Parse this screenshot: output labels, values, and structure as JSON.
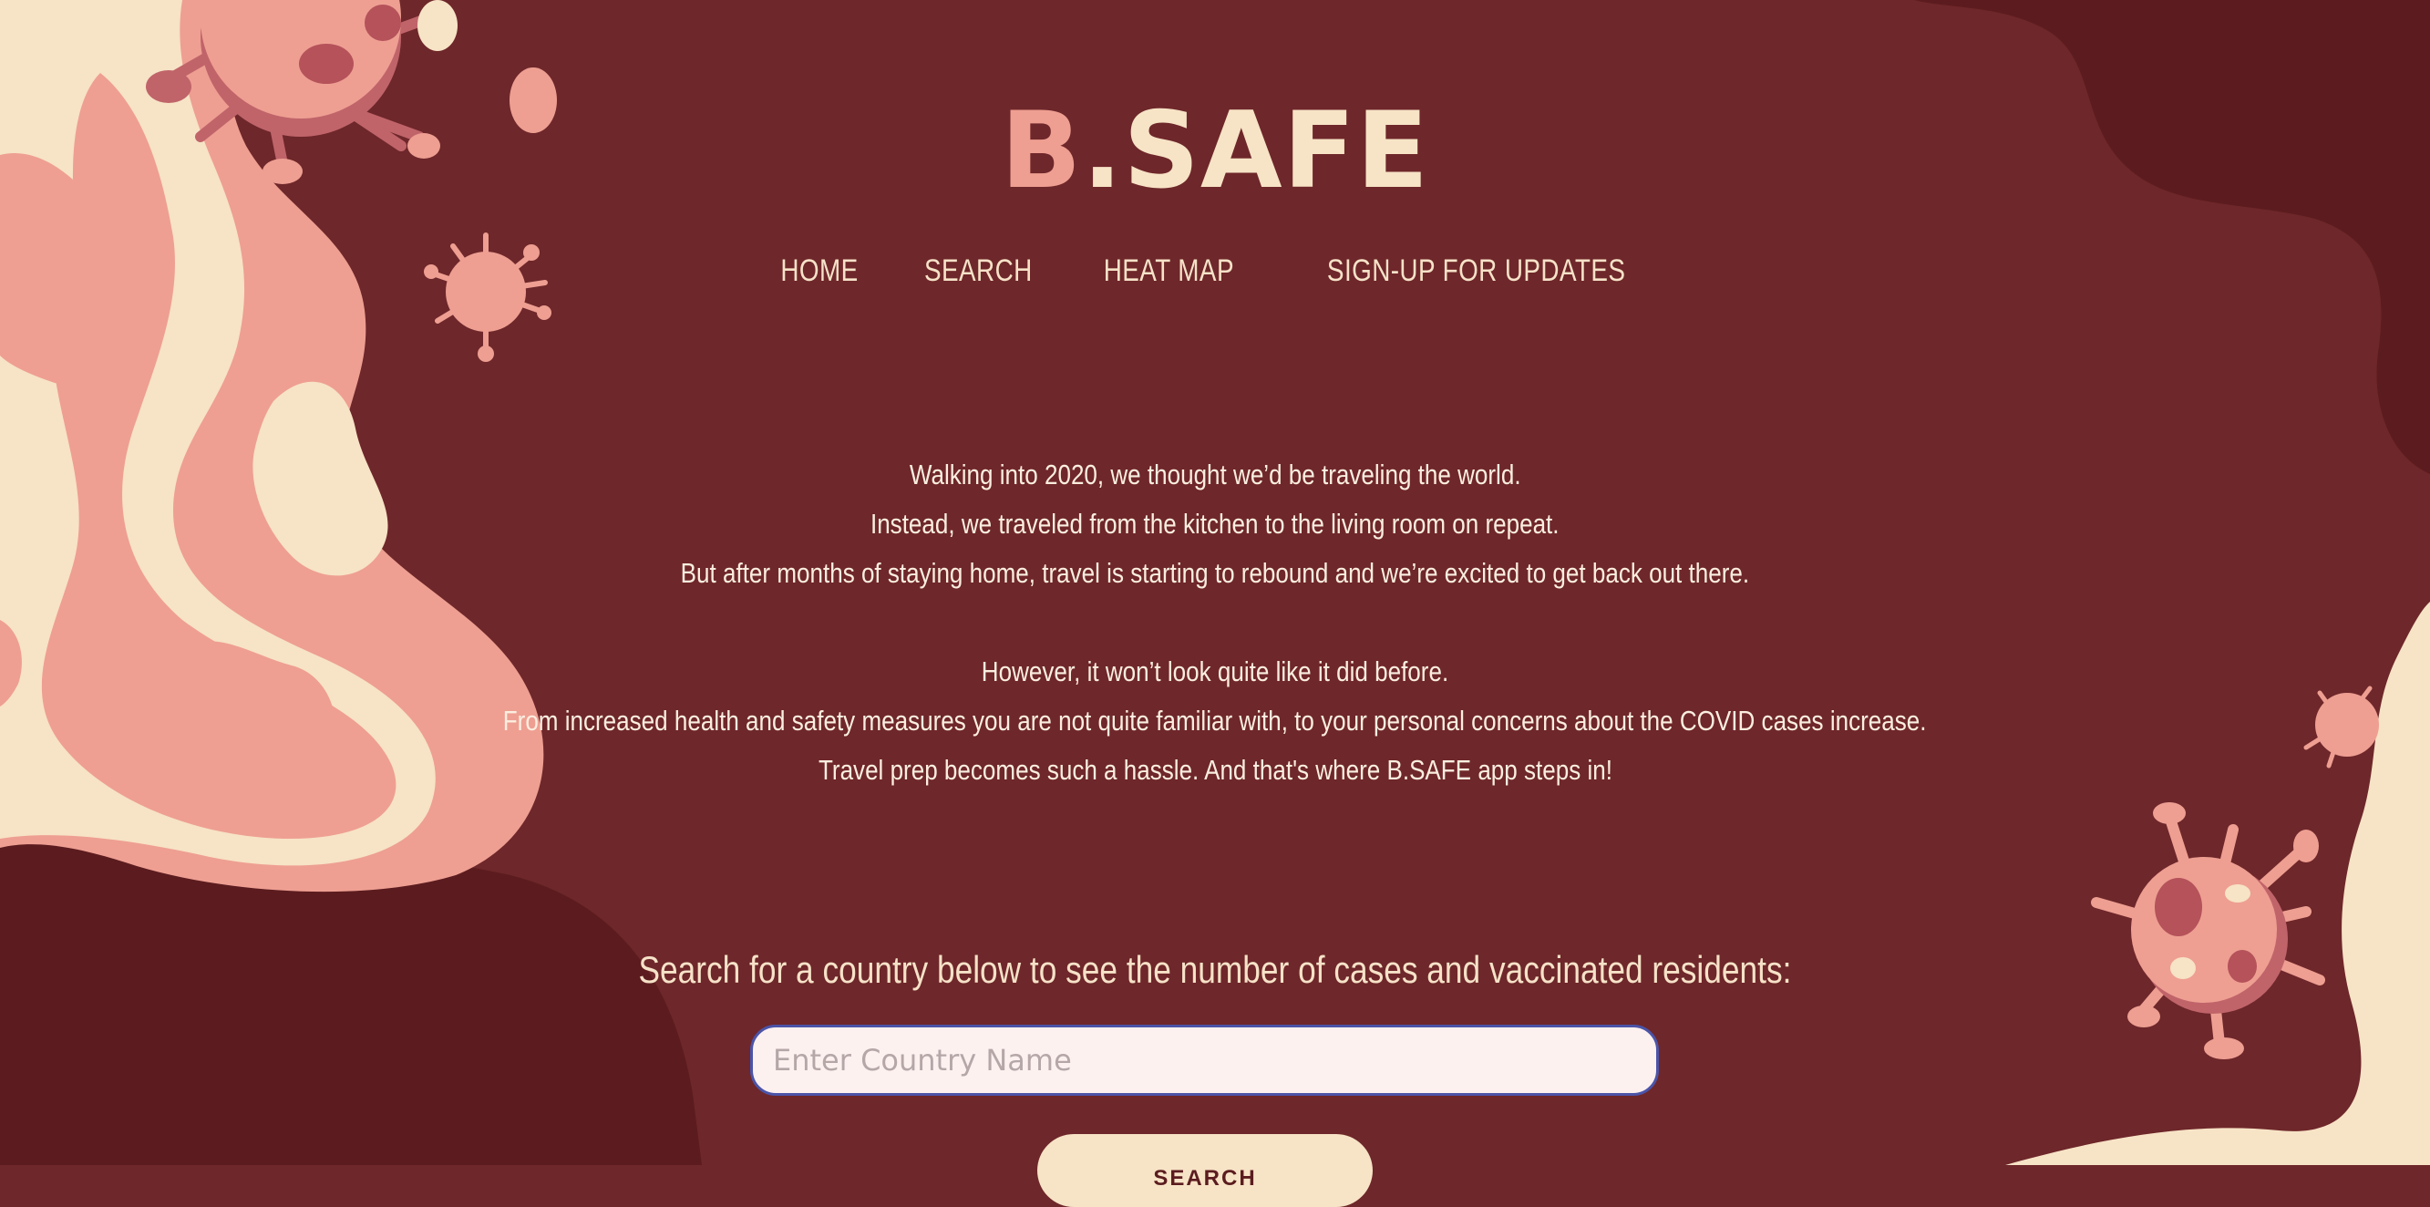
{
  "brand": {
    "logo_first": "B",
    "logo_rest": ".SAFE"
  },
  "nav": [
    {
      "label": "HOME"
    },
    {
      "label": "SEARCH"
    },
    {
      "label": "HEAT MAP"
    },
    {
      "label": "SIGN-UP FOR UPDATES"
    }
  ],
  "intro": {
    "paragraph1": [
      "Walking into 2020, we thought we’d be traveling the world.",
      "Instead, we traveled from the kitchen to the living room on repeat.",
      "But after months of staying home, travel is starting to rebound and we’re excited to get back out there."
    ],
    "paragraph2": [
      "However, it won’t look quite like it did before.",
      "From increased health and safety measures you are not quite familiar with, to your personal concerns about the COVID cases increase.",
      "Travel prep becomes such a hassle. And that's where B.SAFE app steps in!"
    ]
  },
  "search": {
    "prompt": "Search for a country below to see the number of cases and vaccinated residents:",
    "placeholder": "Enter Country Name",
    "value": "",
    "button_label": "SEARCH"
  },
  "colors": {
    "background": "#6e272a",
    "dark_blob": "#5c1c1f",
    "cream": "#f7e3c6",
    "pink": "#ee9f92",
    "virus": "#c0646a",
    "input_border": "#4b54a8"
  },
  "icons": [
    "virus-icon"
  ]
}
